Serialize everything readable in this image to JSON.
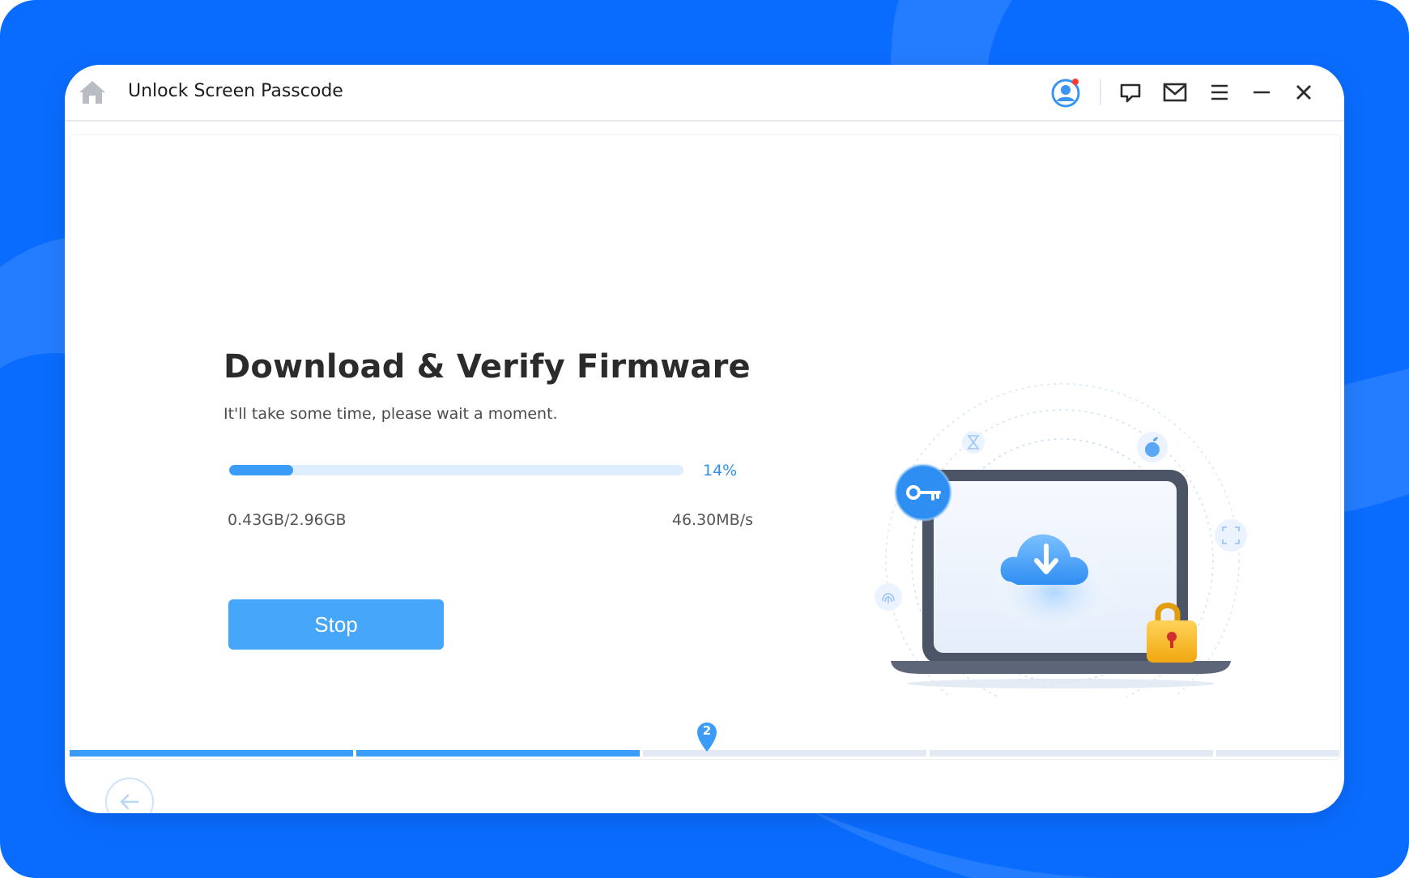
{
  "window": {
    "title": "Unlock Screen Passcode"
  },
  "titlebar_icons": [
    "home-icon",
    "user-avatar-icon",
    "feedback-icon",
    "mail-icon",
    "menu-icon",
    "minimize-icon",
    "close-icon"
  ],
  "main": {
    "heading": "Download & Verify Firmware",
    "subheading": "It'll take some time, please wait a moment.",
    "progress": {
      "percent_label": "14%",
      "fraction": 0.14,
      "size_label": "0.43GB/2.96GB",
      "speed_label": "46.30MB/s"
    },
    "stop_label": "Stop"
  },
  "steps": {
    "current_label": "2",
    "total": 4,
    "current": 2
  },
  "colors": {
    "background": "#0a6cff",
    "accent": "#3b9cf8",
    "button": "#45a6fa",
    "track": "#dfeeff",
    "lock": "#f7b51e"
  }
}
